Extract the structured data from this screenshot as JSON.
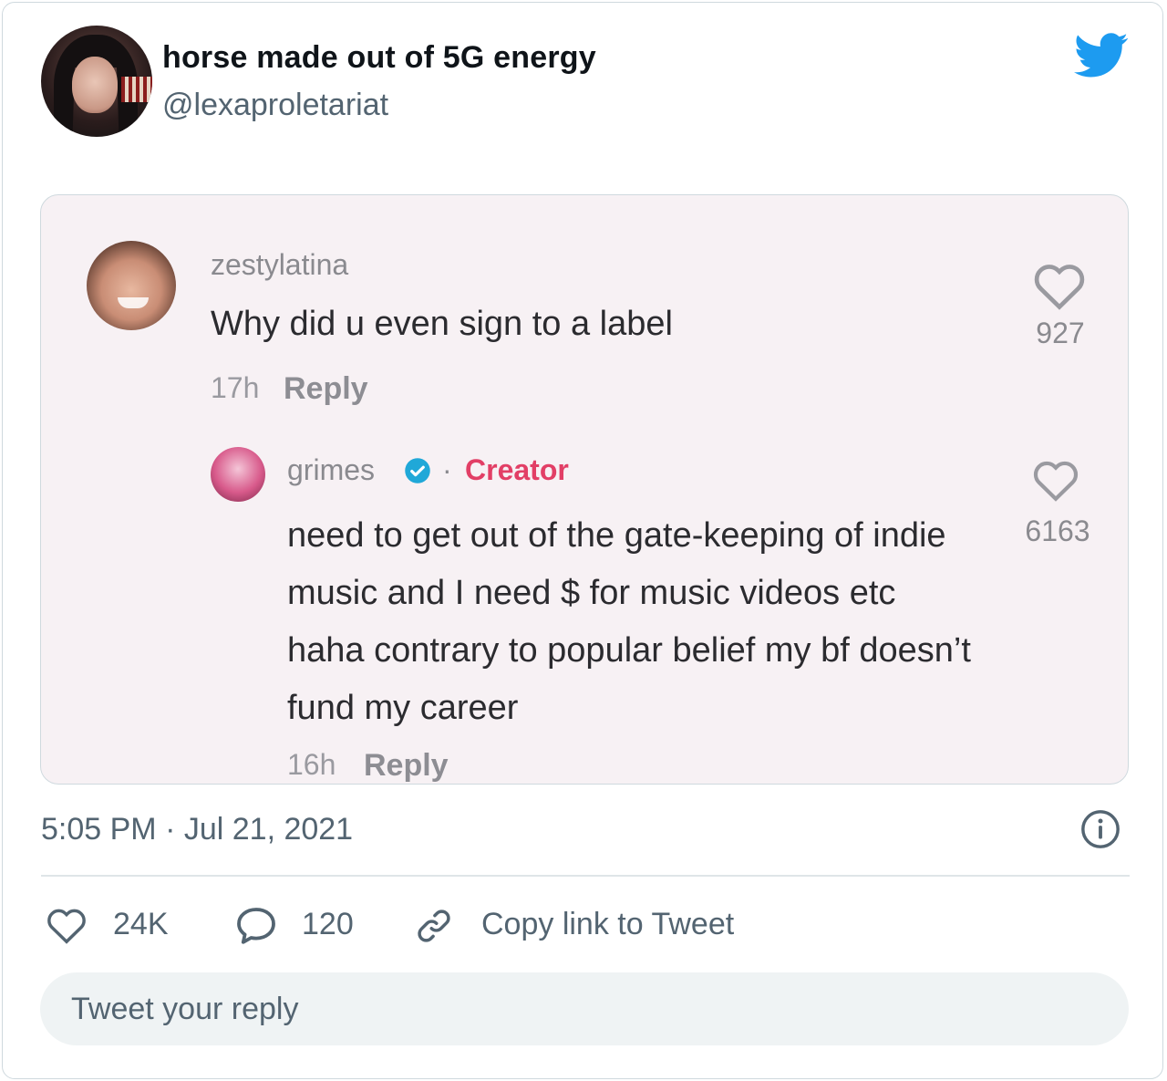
{
  "tweet": {
    "author": {
      "display_name": "horse made out of 5G energy",
      "handle": "@lexaproletariat"
    },
    "timestamp": "5:05 PM · Jul 21, 2021",
    "actions": {
      "like_count": "24K",
      "reply_count": "120",
      "copy_link_label": "Copy link to Tweet"
    },
    "reply_placeholder": "Tweet your reply"
  },
  "embedded_screenshot": {
    "comment": {
      "username": "zestylatina",
      "text": "Why did u even sign to a label",
      "time": "17h",
      "reply_label": "Reply",
      "likes": "927"
    },
    "reply": {
      "username": "grimes",
      "separator": "·",
      "badge": "Creator",
      "text": "need to get out of the gate-keeping of indie music and I need $ for music videos etc haha contrary to popular belief my bf doesn’t fund my career",
      "time": "16h",
      "reply_label": "Reply",
      "likes": "6163"
    }
  },
  "colors": {
    "twitter_blue": "#1d9bf0",
    "creator_red": "#e23f66",
    "verified_blue": "#20a8d8",
    "secondary_text": "#536471"
  },
  "icons": [
    "twitter-bird-icon",
    "heart-icon",
    "verified-icon",
    "info-icon",
    "reply-bubble-icon",
    "link-icon"
  ]
}
